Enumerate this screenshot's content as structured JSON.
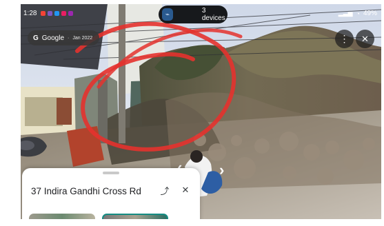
{
  "status_bar": {
    "time": "1:28",
    "battery": "49%"
  },
  "devices_pill": {
    "text": "3 devices"
  },
  "attribution": {
    "provider": "Google",
    "date": "Jan 2022"
  },
  "sheet": {
    "title": "37 Indira Gandhi Cross Rd"
  },
  "icons": {
    "share": "share-icon",
    "close": "close-icon",
    "more": "more-vertical-icon"
  }
}
